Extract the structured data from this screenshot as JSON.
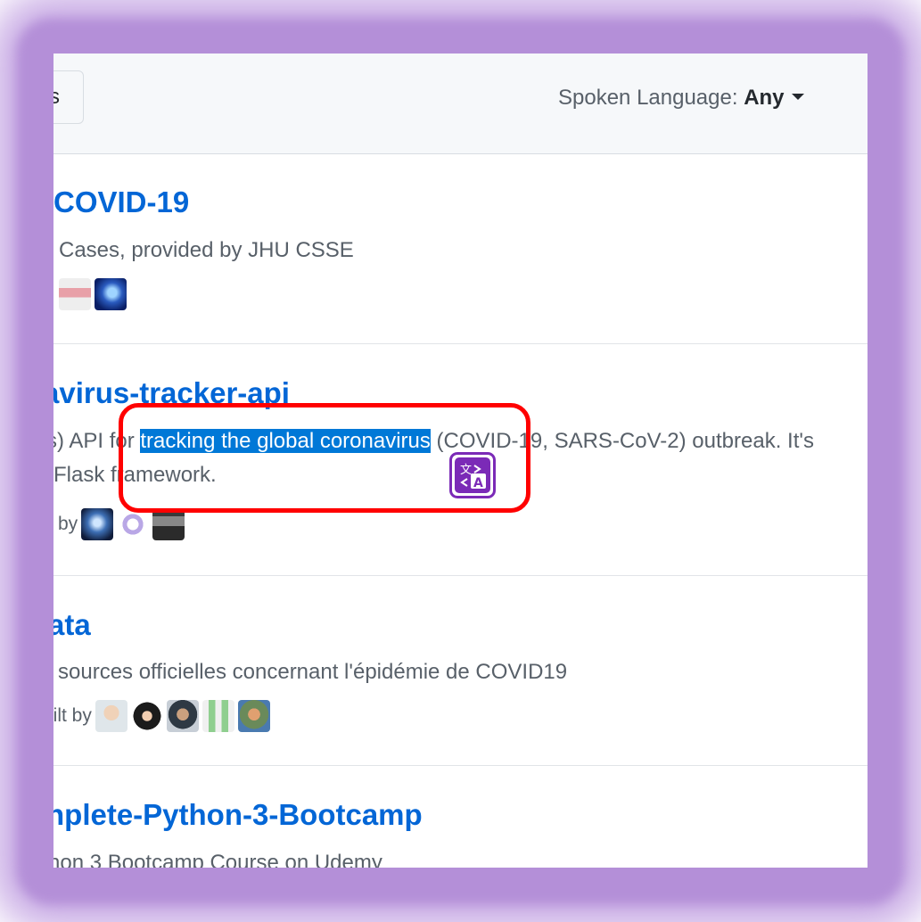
{
  "toolbar": {
    "cut_button_label": "s",
    "spoken_language_label": "Spoken Language: ",
    "spoken_language_value": "Any"
  },
  "repos": [
    {
      "title": "COVID-19",
      "description": "Cases, provided by JHU CSSE",
      "built_by_label": ""
    },
    {
      "title": "avirus-tracker-api",
      "description_before": "s) API for ",
      "description_highlight": "tracking the global coronavirus",
      "description_after": " (COVID-19, SARS-CoV-2) outbreak. It's",
      "description_line2": "Flask framework.",
      "built_by_label": "ilt by"
    },
    {
      "title": "ata",
      "description": "sources officielles concernant l'épidémie de COVID19",
      "built_by_label": "uilt by"
    },
    {
      "title": "nplete-Python-3-Bootcamp",
      "description": "non 3 Bootcamp Course on Udemy"
    }
  ],
  "colors": {
    "link": "#0366d6",
    "highlight": "#0078d7",
    "annotation": "#ff0000",
    "translate": "#7b2ab7"
  },
  "icons": {
    "translate": "translate-icon",
    "caret": "caret-down-icon"
  }
}
